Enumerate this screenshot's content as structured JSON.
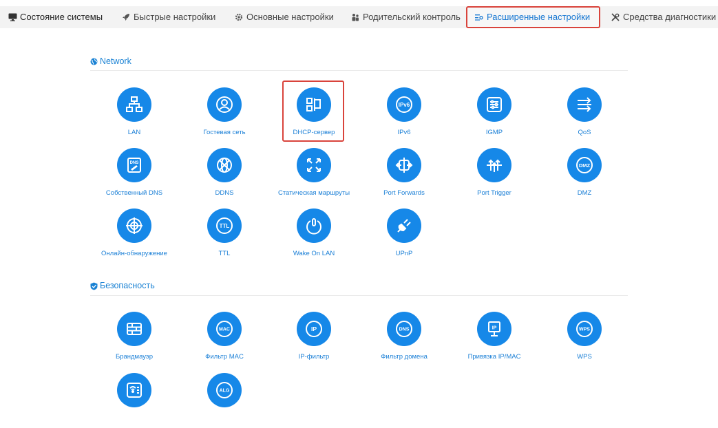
{
  "nav": {
    "items": [
      {
        "label": "Состояние системы",
        "icon": "monitor-icon"
      },
      {
        "label": "Быстрые настройки",
        "icon": "rocket-icon"
      },
      {
        "label": "Основные настройки",
        "icon": "gear-icon"
      },
      {
        "label": "Родительский контроль",
        "icon": "users-icon"
      },
      {
        "label": "Расширенные настройки",
        "icon": "sliders-icon",
        "active": true
      },
      {
        "label": "Средства диагностики",
        "icon": "tools-icon"
      }
    ]
  },
  "sections": {
    "network": {
      "title": "Network",
      "icon": "globe-icon",
      "items": [
        {
          "label": "LAN",
          "icon": "lan-icon"
        },
        {
          "label": "Гостевая сеть",
          "icon": "guest-icon"
        },
        {
          "label": "DHCP-сервер",
          "icon": "dhcp-icon",
          "highlighted": true
        },
        {
          "label": "IPv6",
          "icon": "ipv6-icon",
          "badge": "IPv6"
        },
        {
          "label": "IGMP",
          "icon": "igmp-icon"
        },
        {
          "label": "QoS",
          "icon": "qos-icon"
        },
        {
          "label": "Собственный DNS",
          "icon": "custom-dns-icon",
          "badge": "DNS"
        },
        {
          "label": "DDNS",
          "icon": "ddns-icon"
        },
        {
          "label": "Статическая маршруты",
          "icon": "static-route-icon"
        },
        {
          "label": "Port Forwards",
          "icon": "port-forward-icon"
        },
        {
          "label": "Port Trigger",
          "icon": "port-trigger-icon"
        },
        {
          "label": "DMZ",
          "icon": "dmz-icon",
          "badge": "DMZ"
        },
        {
          "label": "Онлайн-обнаружение",
          "icon": "online-detection-icon"
        },
        {
          "label": "TTL",
          "icon": "ttl-icon",
          "badge": "TTL"
        },
        {
          "label": "Wake On LAN",
          "icon": "wake-on-lan-icon"
        },
        {
          "label": "UPnP",
          "icon": "upnp-icon"
        }
      ]
    },
    "security": {
      "title": "Безопасность",
      "icon": "shield-icon",
      "items": [
        {
          "label": "Брандмауэр",
          "icon": "firewall-icon"
        },
        {
          "label": "Фильтр MAC",
          "icon": "mac-filter-icon",
          "badge": "MAC"
        },
        {
          "label": "IP-фильтр",
          "icon": "ip-filter-icon",
          "badge": "IP"
        },
        {
          "label": "Фильтр домена",
          "icon": "domain-filter-icon",
          "badge": "DNS"
        },
        {
          "label": "Привязка IP/MAC",
          "icon": "ip-mac-binding-icon",
          "badge": "IP"
        },
        {
          "label": "WPS",
          "icon": "wps-icon",
          "badge": "WPS"
        },
        {
          "label": "",
          "icon": "wifi-schedule-icon"
        },
        {
          "label": "",
          "icon": "alg-icon",
          "badge": "ALG"
        }
      ]
    }
  },
  "colors": {
    "accent": "#1688e8",
    "highlight": "#d9433b",
    "nav_bg": "#f3f3f3"
  }
}
